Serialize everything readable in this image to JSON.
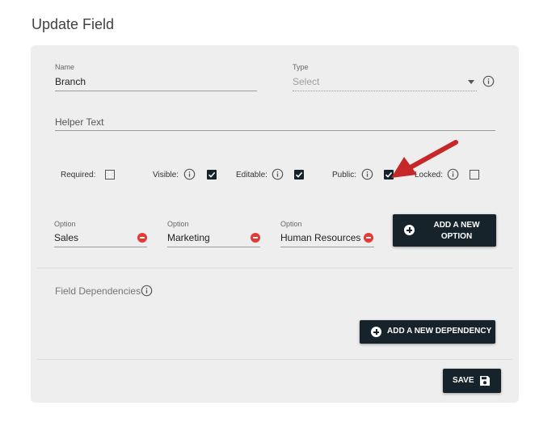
{
  "page": {
    "title": "Update Field"
  },
  "form": {
    "name": {
      "label": "Name",
      "value": "Branch"
    },
    "type": {
      "label": "Type",
      "placeholder": "Select"
    },
    "helper": {
      "placeholder": "Helper Text"
    }
  },
  "flags": {
    "required": {
      "label": "Required:",
      "checked": false
    },
    "visible": {
      "label": "Visible:",
      "checked": true
    },
    "editable": {
      "label": "Editable:",
      "checked": true
    },
    "public": {
      "label": "Public:",
      "checked": true
    },
    "locked": {
      "label": "Locked:",
      "checked": false
    }
  },
  "options": {
    "items": [
      {
        "label": "Option",
        "value": "Sales"
      },
      {
        "label": "Option",
        "value": "Marketing"
      },
      {
        "label": "Option",
        "value": "Human Resources"
      }
    ],
    "add_label_line1": "ADD A NEW",
    "add_label_line2": "OPTION"
  },
  "dependencies": {
    "title": "Field Dependencies",
    "add_label": "ADD A NEW DEPENDENCY"
  },
  "actions": {
    "save_label": "SAVE"
  },
  "colors": {
    "button_bg": "#16232b",
    "remove_red": "#e53935",
    "annotation_arrow": "#c62828",
    "card_bg": "#eeeeee"
  },
  "icons": [
    "info-icon",
    "chevron-down-icon",
    "check-icon",
    "remove-circle-icon",
    "add-circle-icon",
    "save-icon",
    "arrow-annotation"
  ]
}
